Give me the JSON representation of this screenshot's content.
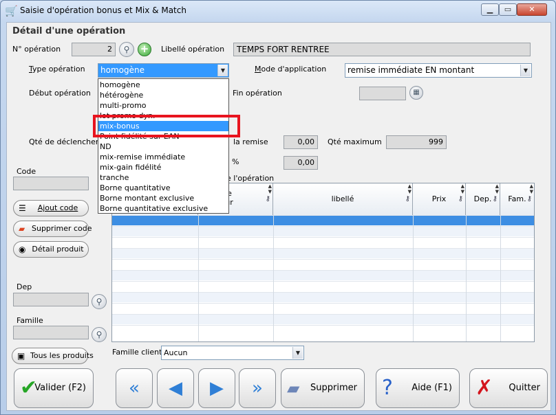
{
  "window": {
    "title": "Saisie d'opération bonus et Mix & Match",
    "title_icon": "cart-icon"
  },
  "section_title": "Détail d'une opération",
  "op_number": {
    "label": "N° opération",
    "value": "2"
  },
  "libelle": {
    "label": "Libellé opération",
    "value": "TEMPS FORT RENTREE"
  },
  "type_operation": {
    "label": "Type opération",
    "selected": "homogène",
    "options": [
      "homogène",
      "hétérogène",
      "multi-promo",
      "lot promo dyn.",
      "mix-bonus",
      "Point fidélité sur EAN",
      "ND",
      "mix-remise immédiate",
      "mix-gain fidélité",
      "tranche",
      "Borne quantitative",
      "Borne montant exclusive",
      "Borne quantitative exclusive"
    ],
    "highlighted": "mix-bonus"
  },
  "mode_application": {
    "label": "Mode d'application",
    "selected": "remise immédiate EN montant"
  },
  "debut_operation": {
    "label": "Début opération"
  },
  "fin_operation": {
    "label": "Fin opération",
    "value": ""
  },
  "qte_declenchement": {
    "label": "Qté de déclenchement"
  },
  "remise": {
    "label": "la remise",
    "value": "0,00"
  },
  "qte_maximum": {
    "label": "Qté maximum",
    "value": "999"
  },
  "percent": {
    "label": "%",
    "value": "0,00"
  },
  "produits_title": "e l'opération",
  "code": {
    "label": "Code",
    "value": ""
  },
  "buttons": {
    "ajout_code": "Ajout code",
    "supprimer_code": "Supprimer code",
    "detail_produit": "Détail produit",
    "tous_produits": "Tous les produits"
  },
  "dep": {
    "label": "Dep",
    "value": ""
  },
  "famille": {
    "label": "Famille",
    "value": ""
  },
  "famille_client": {
    "label": "Famille client",
    "selected": "Aucun"
  },
  "grid": {
    "columns": [
      "",
      "rence\nisseur",
      "libellé",
      "Prix",
      "Dep.",
      "Fam."
    ],
    "rows": 11,
    "selected_row": 0
  },
  "bottom": {
    "valider": "Valider (F2)",
    "supprimer": "Supprimer",
    "aide": "Aide (F1)",
    "quitter": "Quitter"
  },
  "colors": {
    "selection": "#3399ff",
    "highlight_box": "#e8141f",
    "grid_selection": "#3d8ee3"
  }
}
